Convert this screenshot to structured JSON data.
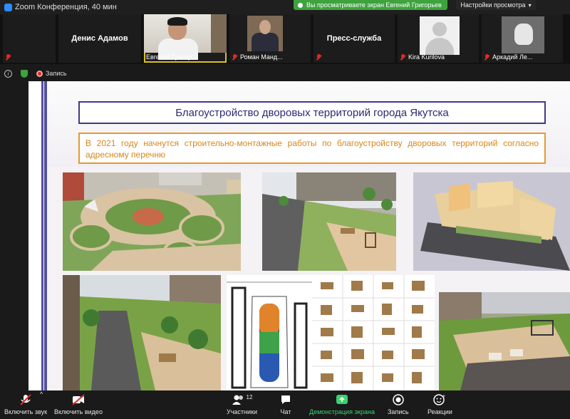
{
  "titlebar": {
    "title": "Zoom Конференция, 40 мин"
  },
  "share_banner": {
    "text": "Вы просматриваете экран Евгений Григорьев"
  },
  "view_settings": {
    "label": "Настройки просмотра"
  },
  "participants": [
    {
      "name": "Денис Адамов",
      "kind": "name-only"
    },
    {
      "name": "Евгений Григор...",
      "kind": "video"
    },
    {
      "name": "Роман Манд...",
      "kind": "photo"
    },
    {
      "name": "Пресс-служба",
      "kind": "name-only"
    },
    {
      "name": "Kira Kurilova",
      "kind": "photo"
    },
    {
      "name": "Аркадий Ле...",
      "kind": "photo"
    }
  ],
  "meeting_bar": {
    "record_label": "Запись"
  },
  "slide": {
    "title": "Благоустройство дворовых территорий города Якутска",
    "subtitle": "В 2021 году начнутся строительно-монтажные работы по благоустройству дворовых территорий согласно адресному перечню"
  },
  "toolbar": {
    "audio_label": "Включить звук",
    "video_label": "Включить видео",
    "participants_label": "Участники",
    "participants_count": "12",
    "chat_label": "Чат",
    "share_label": "Демонстрация экрана",
    "record_label": "Запись",
    "reactions_label": "Реакции"
  },
  "colors": {
    "share_green": "#3ea23e",
    "active_speaker": "#d9c21a",
    "slide_title": "#2d2a70",
    "slide_orange": "#e39a2c"
  }
}
